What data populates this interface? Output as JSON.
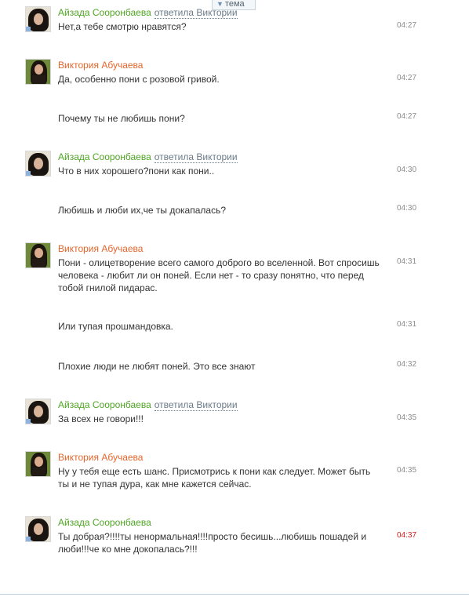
{
  "topic_tab": {
    "label": "тема",
    "arrow_icon": "triangle-down-icon"
  },
  "colors": {
    "author_a": "#4fa524",
    "author_v": "#e2662c",
    "reply_link": "#6b7b88",
    "new_time": "#d41a1a"
  },
  "messages": [
    {
      "author": "Айзада Сооронбаева",
      "reply_label": "ответила Виктории",
      "text": "Нет,а тебе смотрю нравятся?",
      "time": "04:27"
    },
    {
      "author": "Виктория Абучаева",
      "text": "Да, особенно пони с розовой гривой.",
      "time": "04:27"
    },
    {
      "text": "Почему ты не любишь пони?",
      "time": "04:27"
    },
    {
      "author": "Айзада Сооронбаева",
      "reply_label": "ответила Виктории",
      "text": "Что в них хорошего?пони как пони..",
      "time": "04:30"
    },
    {
      "text": "Любишь и люби их,че ты докапалась?",
      "time": "04:30"
    },
    {
      "author": "Виктория Абучаева",
      "text": "Пони - олицетворение всего самого доброго во вселенной. Вот спросишь человека - любит ли он поней. Если нет - то сразу понятно, что перед тобой гнилой пидарас.",
      "time": "04:31"
    },
    {
      "text": "Или тупая прошмандовка.",
      "time": "04:31"
    },
    {
      "text": "Плохие люди не любят поней. Это все знают",
      "time": "04:32"
    },
    {
      "author": "Айзада Сооронбаева",
      "reply_label": "ответила Виктории",
      "text": "За всех не говори!!!",
      "time": "04:35"
    },
    {
      "author": "Виктория Абучаева",
      "text": "Ну у тебя еще есть шанс. Присмотрись к пони как следует. Может быть ты и не тупая дура, как мне кажется сейчас.",
      "time": "04:35"
    },
    {
      "author": "Айзада Сооронбаева",
      "text": "Ты добрая?!!!!ты ненормальная!!!!просто бесишь...любишь пошадей и люби!!!че ко мне докопалась?!!!",
      "time": "04:37"
    }
  ]
}
